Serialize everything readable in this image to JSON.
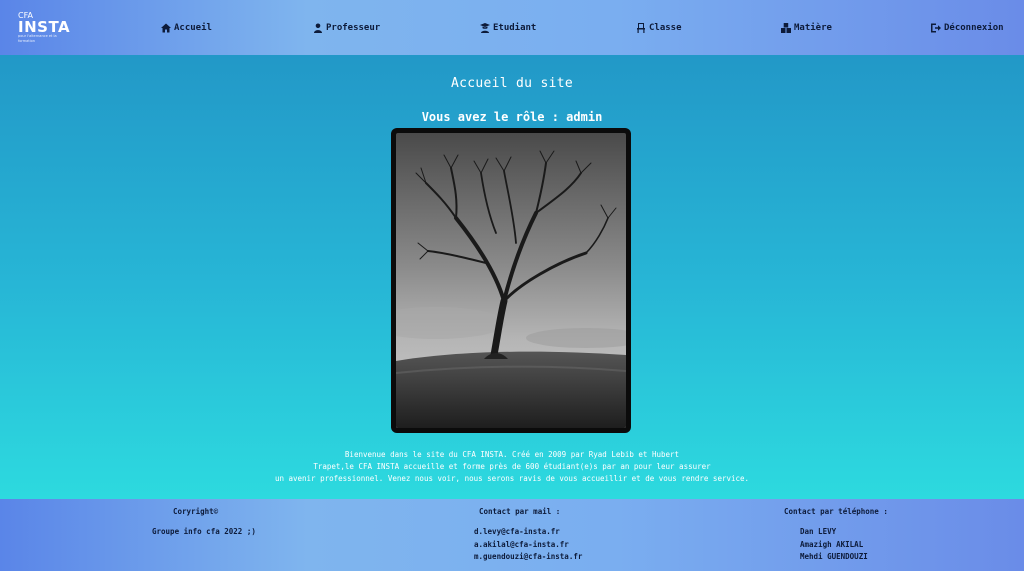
{
  "logo": {
    "cfa": "CFA",
    "brand": "INSTA",
    "tag": "pour l'alternance et la formation"
  },
  "nav": {
    "accueil": "Accueil",
    "professeur": "Professeur",
    "etudiant": "Etudiant",
    "classe": "Classe",
    "matiere": "Matière",
    "deconnexion": "Déconnexion"
  },
  "main": {
    "title": "Accueil du site",
    "role": "Vous avez le rôle : admin",
    "description": [
      "Bienvenue dans le site du CFA INSTA. Créé en 2009 par Ryad Lebib et Hubert",
      "Trapet,le CFA INSTA accueille et forme près de 600 étudiant(e)s par an pour leur assurer",
      "un avenir professionnel. Venez nous voir, nous serons ravis de vous accueillir et de vous rendre service."
    ]
  },
  "footer": {
    "copyright": {
      "head": "Coryright©",
      "text": "Groupe info cfa 2022 ;)"
    },
    "mail": {
      "head": "Contact par mail :",
      "emails": [
        "d.levy@cfa-insta.fr",
        "a.akilal@cfa-insta.fr",
        "m.guendouzi@cfa-insta.fr"
      ]
    },
    "phone": {
      "head": "Contact par téléphone :",
      "names": [
        "Dan LEVY",
        "Amazigh AKILAL",
        "Mehdi GUENDOUZI"
      ]
    }
  },
  "colors": {
    "nav_text": "#0d1b3a",
    "bg_top": "#2191c4",
    "bg_bottom": "#2fe6e2"
  }
}
